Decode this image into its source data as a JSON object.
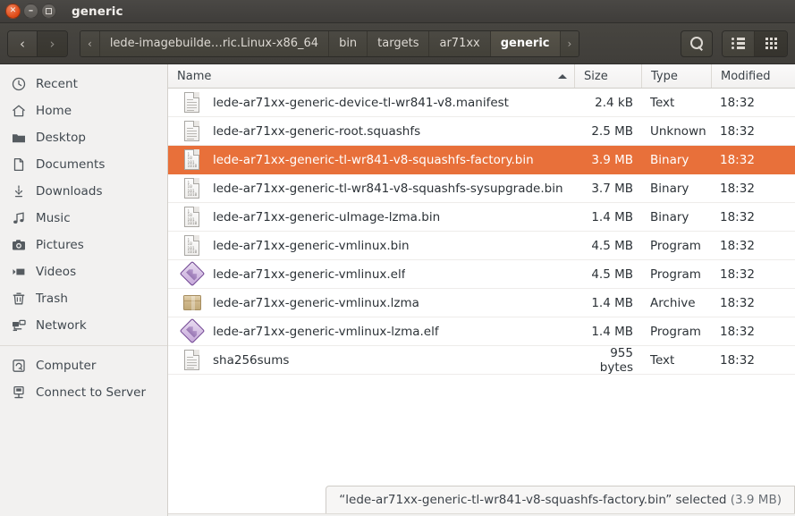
{
  "window": {
    "title": "generic",
    "buttons": [
      {
        "name": "close",
        "glyph": "×"
      },
      {
        "name": "minimize",
        "glyph": "−"
      },
      {
        "name": "maximize",
        "glyph": ""
      }
    ]
  },
  "toolbar": {
    "back_label": "‹",
    "forward_label": "›",
    "breadcrumbs": [
      {
        "label": "‹",
        "kind": "arrow"
      },
      {
        "label": "lede-imagebuilde…ric.Linux-x86_64",
        "kind": "path"
      },
      {
        "label": "bin",
        "kind": "path"
      },
      {
        "label": "targets",
        "kind": "path"
      },
      {
        "label": "ar71xx",
        "kind": "path"
      },
      {
        "label": "generic",
        "kind": "current"
      },
      {
        "label": "›",
        "kind": "tail"
      }
    ],
    "search_label": "Search",
    "view_list_label": "List view",
    "view_grid_label": "Icon view"
  },
  "sidebar": {
    "items": [
      {
        "label": "Recent",
        "icon": "clock-icon"
      },
      {
        "label": "Home",
        "icon": "home-icon"
      },
      {
        "label": "Desktop",
        "icon": "folder-icon"
      },
      {
        "label": "Documents",
        "icon": "document-icon"
      },
      {
        "label": "Downloads",
        "icon": "download-icon"
      },
      {
        "label": "Music",
        "icon": "music-note-icon"
      },
      {
        "label": "Pictures",
        "icon": "camera-icon"
      },
      {
        "label": "Videos",
        "icon": "video-icon"
      },
      {
        "label": "Trash",
        "icon": "trash-icon"
      },
      {
        "label": "Network",
        "icon": "network-icon"
      }
    ],
    "items2": [
      {
        "label": "Computer",
        "icon": "computer-icon"
      },
      {
        "label": "Connect to Server",
        "icon": "server-icon"
      }
    ]
  },
  "filelist": {
    "columns": [
      {
        "key": "name",
        "label": "Name",
        "sorted": true
      },
      {
        "key": "size",
        "label": "Size"
      },
      {
        "key": "type",
        "label": "Type"
      },
      {
        "key": "modified",
        "label": "Modified"
      }
    ],
    "rows": [
      {
        "name": "lede-ar71xx-generic-device-tl-wr841-v8.manifest",
        "size": "2.4 kB",
        "type": "Text",
        "modified": "18:32",
        "icon": "text-file-icon",
        "selected": false
      },
      {
        "name": "lede-ar71xx-generic-root.squashfs",
        "size": "2.5 MB",
        "type": "Unknown",
        "modified": "18:32",
        "icon": "text-file-icon",
        "selected": false
      },
      {
        "name": "lede-ar71xx-generic-tl-wr841-v8-squashfs-factory.bin",
        "size": "3.9 MB",
        "type": "Binary",
        "modified": "18:32",
        "icon": "binary-file-icon",
        "selected": true
      },
      {
        "name": "lede-ar71xx-generic-tl-wr841-v8-squashfs-sysupgrade.bin",
        "size": "3.7 MB",
        "type": "Binary",
        "modified": "18:32",
        "icon": "binary-file-icon",
        "selected": false
      },
      {
        "name": "lede-ar71xx-generic-uImage-lzma.bin",
        "size": "1.4 MB",
        "type": "Binary",
        "modified": "18:32",
        "icon": "binary-file-icon",
        "selected": false
      },
      {
        "name": "lede-ar71xx-generic-vmlinux.bin",
        "size": "4.5 MB",
        "type": "Program",
        "modified": "18:32",
        "icon": "binary-file-icon",
        "selected": false
      },
      {
        "name": "lede-ar71xx-generic-vmlinux.elf",
        "size": "4.5 MB",
        "type": "Program",
        "modified": "18:32",
        "icon": "executable-file-icon",
        "selected": false
      },
      {
        "name": "lede-ar71xx-generic-vmlinux.lzma",
        "size": "1.4 MB",
        "type": "Archive",
        "modified": "18:32",
        "icon": "archive-file-icon",
        "selected": false
      },
      {
        "name": "lede-ar71xx-generic-vmlinux-lzma.elf",
        "size": "1.4 MB",
        "type": "Program",
        "modified": "18:32",
        "icon": "executable-file-icon",
        "selected": false
      },
      {
        "name": "sha256sums",
        "size": "955 bytes",
        "type": "Text",
        "modified": "18:32",
        "icon": "text-file-icon",
        "selected": false
      }
    ]
  },
  "statusbar": {
    "selection_text": "“lede-ar71xx-generic-tl-wr841-v8-squashfs-factory.bin” selected",
    "selection_size": "(3.9 MB)"
  },
  "colors": {
    "accent": "#e8703a",
    "titlebar": "#474540",
    "sidebar": "#f2f1f0",
    "text": "#2c3237"
  }
}
